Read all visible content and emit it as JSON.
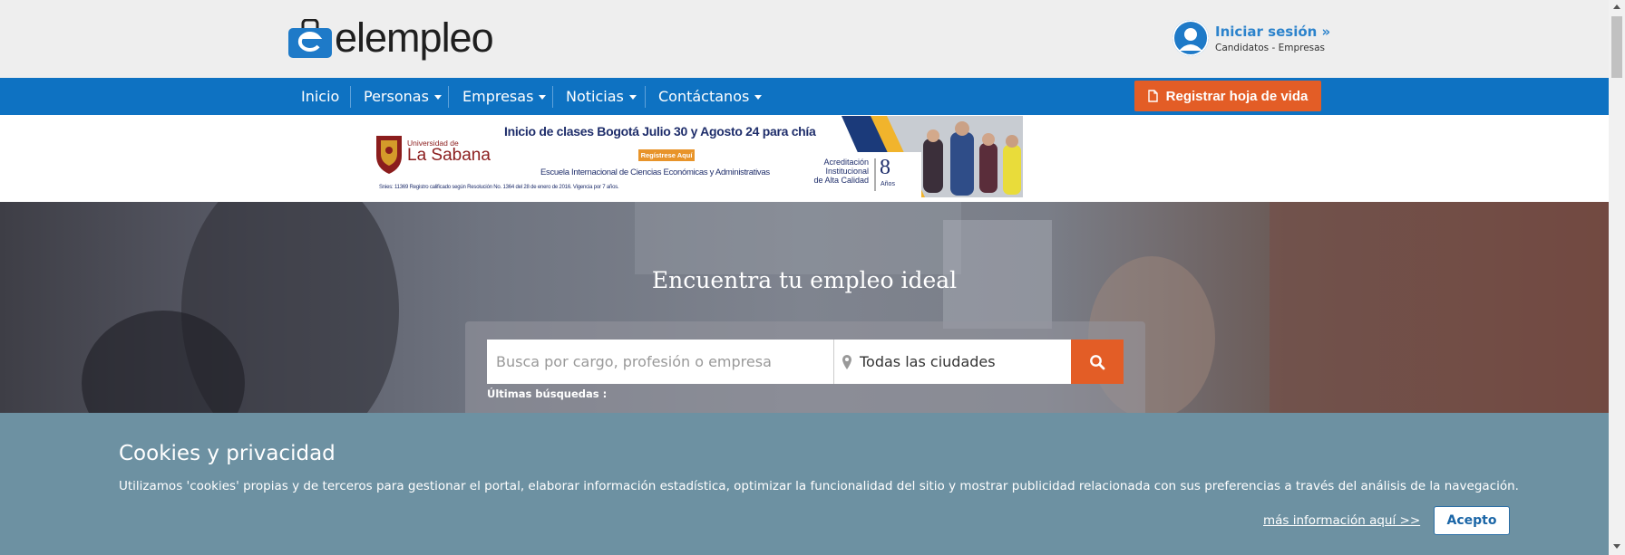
{
  "brand": {
    "name": "elempleo"
  },
  "login": {
    "title": "Iniciar sesión »",
    "subtitle": "Candidatos - Empresas"
  },
  "nav": {
    "items": [
      {
        "label": "Inicio"
      },
      {
        "label": "Personas"
      },
      {
        "label": "Empresas"
      },
      {
        "label": "Noticias"
      },
      {
        "label": "Contáctanos"
      }
    ],
    "register_button": "Registrar hoja de vida"
  },
  "ad": {
    "logo_small": "Universidad de",
    "logo_big": "La Sabana",
    "headline": "Inicio de clases Bogotá Julio 30 y Agosto 24 para chía",
    "cta": "Regístrese Aquí",
    "school": "Escuela Internacional  de Ciencias Económicas y Administrativas",
    "legal": "Snies: 11369  Registro calificado según Resolución No. 1364 del 28 de enero de 2016. Vigencia por 7 años.",
    "accred_line1": "Acreditación",
    "accred_line2": "Institucional",
    "accred_line3": "de Alta Calidad",
    "accred_years": "8",
    "accred_unit": "Años"
  },
  "hero": {
    "title": "Encuentra tu empleo ideal",
    "search_placeholder": "Busca por cargo, profesión o empresa",
    "city_value": "Todas las ciudades",
    "recent_label": "Últimas búsquedas :"
  },
  "cookies": {
    "title": "Cookies y privacidad",
    "body": "Utilizamos 'cookies' propias y de terceros para gestionar el portal, elaborar información estadística, optimizar la funcionalidad del sitio y mostrar publicidad relacionada con sus preferencias a través del análisis de la navegación.",
    "more_link": "más información aquí >>",
    "accept": "Acepto"
  },
  "colors": {
    "nav_blue": "#0e72c2",
    "accent_orange": "#e35d26",
    "cookie_bg": "#6d91a2",
    "link_blue": "#2c83cc"
  },
  "icons": [
    "elempleo-logo-icon",
    "user-avatar-icon",
    "caret-down-icon",
    "document-icon",
    "map-pin-icon",
    "search-icon"
  ]
}
